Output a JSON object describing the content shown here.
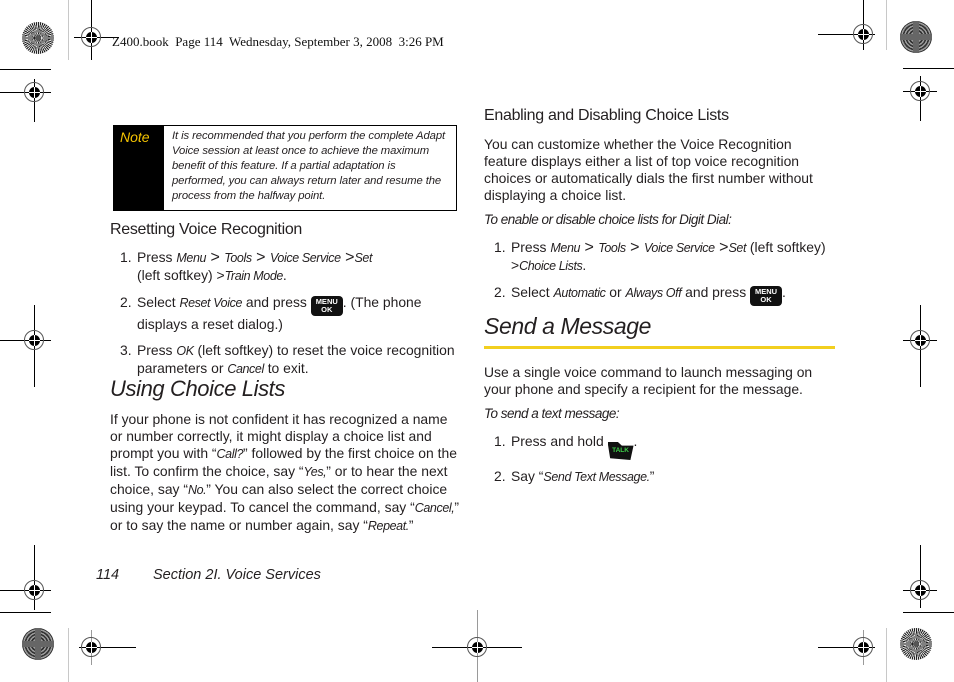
{
  "slug": "Z400.book  Page 114  Wednesday, September 3, 2008  3:26 PM",
  "note": {
    "label": "Note",
    "text": "It is recommended that you perform the complete Adapt Voice session at least once to achieve the maximum benefit of this feature. If a partial adaptation is performed, you can always return later and resume the process from the halfway point."
  },
  "left_column": {
    "resetting": {
      "heading": "Resetting Voice Recognition",
      "steps": [
        {
          "num": "1.",
          "parts": [
            "Press ",
            "Menu",
            " > ",
            "Tools",
            " > ",
            "Voice Service",
            " >",
            "Set",
            " (left softkey) >",
            "Train Mode",
            "."
          ]
        },
        {
          "num": "2.",
          "parts": [
            "Select ",
            "Reset Voice",
            " and press ",
            "MENU OK",
            ". (The phone displays a reset dialog.)"
          ]
        },
        {
          "num": "3.",
          "parts": [
            "Press ",
            "OK",
            " (left softkey) to reset the voice recognition parameters or ",
            "Cancel",
            " to exit."
          ]
        }
      ]
    },
    "using": {
      "heading": "Using Choice Lists",
      "paragraph": {
        "t1": "If your phone is not confident it has recognized a name or number correctly, it might display a choice list and prompt you with “",
        "i1": "Call?",
        "t2": "” followed by the first choice on the list. To confirm the choice, say “",
        "i2": "Yes,",
        "t3": "” or to hear the next choice, say “",
        "i3": "No.",
        "t4": "” You can also select the correct choice using your keypad. To cancel the command, say “",
        "i4": "Cancel,",
        "t5": "” or to say the name or number again, say “",
        "i5": "Repeat.",
        "t6": "”"
      }
    }
  },
  "right_column": {
    "enabling": {
      "heading": "Enabling and Disabling Choice Lists",
      "paragraph": "You can customize whether the Voice Recognition feature displays either a list of top voice recognition choices or automatically dials the first number without displaying a choice list.",
      "lead": "To enable or disable choice lists for Digit Dial:",
      "steps": [
        {
          "num": "1.",
          "parts": [
            "Press ",
            "Menu",
            " > ",
            "Tools",
            " > ",
            "Voice Service",
            " >",
            "Set",
            " (left softkey) >",
            "Choice Lists",
            "."
          ]
        },
        {
          "num": "2.",
          "parts": [
            "Select ",
            "Automatic",
            " or ",
            "Always Off",
            " and press ",
            "MENU OK",
            "."
          ]
        }
      ]
    },
    "send": {
      "heading": "Send a Message",
      "paragraph": "Use a single voice command to launch messaging on your phone and specify a recipient for the message.",
      "lead": "To send a text message:",
      "steps": [
        {
          "num": "1.",
          "parts": [
            "Press and hold ",
            "TALK",
            "."
          ]
        },
        {
          "num": "2.",
          "parts": [
            "Say “",
            "Send Text Message.",
            "”"
          ]
        }
      ]
    }
  },
  "keys": {
    "menu_line1": "MENU",
    "menu_line2": "OK",
    "talk": "TALK"
  },
  "footer": {
    "page_number": "114",
    "section": "Section 2I. Voice Services"
  },
  "colors": {
    "note_label": "#f5c400",
    "rule": "#f2cf1f",
    "talk_text": "#3fd14a"
  }
}
